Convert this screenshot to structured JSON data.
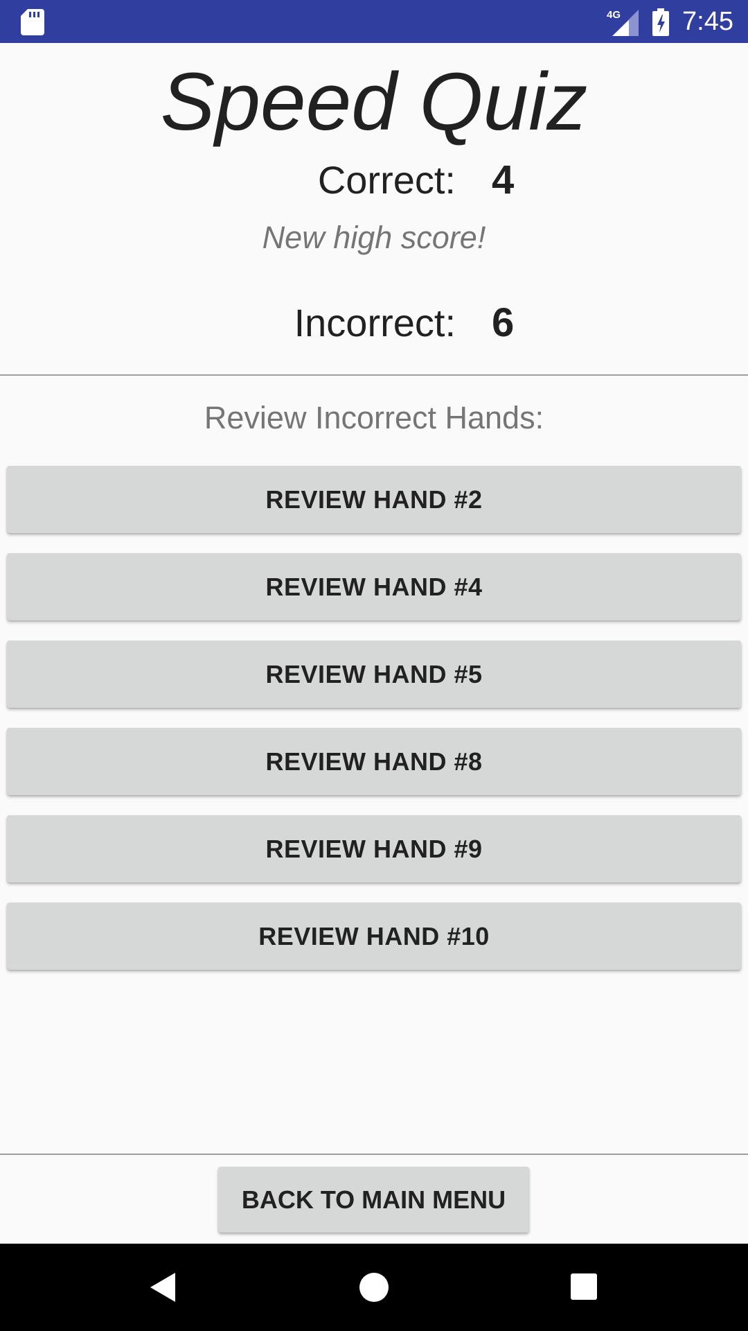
{
  "status_bar": {
    "network_type": "4G",
    "time": "7:45",
    "color": "#303f9f"
  },
  "title": "Speed Quiz",
  "score": {
    "correct_label": "Correct:",
    "correct_value": "4",
    "high_score_text": "New high score!",
    "incorrect_label": "Incorrect:",
    "incorrect_value": "6"
  },
  "review": {
    "heading": "Review Incorrect Hands:",
    "buttons": [
      "REVIEW HAND #2",
      "REVIEW HAND #4",
      "REVIEW HAND #5",
      "REVIEW HAND #8",
      "REVIEW HAND #9",
      "REVIEW HAND #10"
    ]
  },
  "back_button": "BACK TO MAIN MENU",
  "icons": {
    "status": [
      "sd-card-icon",
      "signal-icon",
      "battery-charging-icon"
    ],
    "nav": [
      "back-icon",
      "home-icon",
      "recents-icon"
    ]
  }
}
